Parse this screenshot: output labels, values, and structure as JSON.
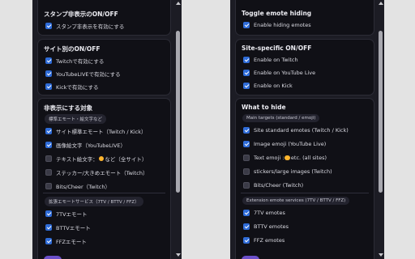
{
  "left": {
    "section1": {
      "title": "スタンプ非表示のON/OFF",
      "options": [
        {
          "label": "スタンプ非表示を有効にする",
          "checked": true
        }
      ]
    },
    "section2": {
      "title": "サイト別のON/OFF",
      "options": [
        {
          "label": "Twitchで有効にする",
          "checked": true
        },
        {
          "label": "YouTubeLIVEで有効にする",
          "checked": true
        },
        {
          "label": "Kickで有効にする",
          "checked": true
        }
      ]
    },
    "section3": {
      "title": "非表示にする対象",
      "group1_label": "標準エモート・絵文字など",
      "group1": [
        {
          "label": "サイト標準エモート（Twitch / Kick）",
          "checked": true
        },
        {
          "label": "画像絵文字（YouTubeLIVE）",
          "checked": true
        },
        {
          "label_before": "テキスト絵文字：",
          "label_after": "など（全サイト）",
          "checked": false
        },
        {
          "label": "ステッカー/大きめエモート（Twitch）",
          "checked": false
        },
        {
          "label": "Bits/Cheer（Twitch）",
          "checked": false
        }
      ],
      "group2_label": "拡張エモートサービス（7TV / BTTV / FFZ）",
      "group2": [
        {
          "label": "7TVエモート",
          "checked": true
        },
        {
          "label": "BTTVエモート",
          "checked": true
        },
        {
          "label": "FFZエモート",
          "checked": true
        }
      ]
    }
  },
  "right": {
    "section1": {
      "title": "Toggle emote hiding",
      "options": [
        {
          "label": "Enable hiding emotes",
          "checked": true
        }
      ]
    },
    "section2": {
      "title": "Site-specific ON/OFF",
      "options": [
        {
          "label": "Enable on Twitch",
          "checked": true
        },
        {
          "label": "Enable on YouTube Live",
          "checked": true
        },
        {
          "label": "Enable on Kick",
          "checked": true
        }
      ]
    },
    "section3": {
      "title": "What to hide",
      "group1_label": "Main targets (standard / emoji)",
      "group1": [
        {
          "label": "Site standard emotes (Twitch / Kick)",
          "checked": true
        },
        {
          "label": "Image emoji (YouTube Live)",
          "checked": true
        },
        {
          "label_before": "Text emoji :",
          "label_after": "etc. (all sites)",
          "checked": false
        },
        {
          "label": "stickers/large images (Twitch)",
          "checked": false
        },
        {
          "label": "Bits/Cheer (Twitch)",
          "checked": false
        }
      ],
      "group2_label": "Extension emote services (7TV / BTTV / FFZ)",
      "group2": [
        {
          "label": "7TV emotes",
          "checked": true
        },
        {
          "label": "BTTV emotes",
          "checked": true
        },
        {
          "label": "FFZ emotes",
          "checked": true
        }
      ]
    }
  },
  "colors": {
    "accent": "#2f6cd8",
    "panel_bg": "#1c1c24",
    "card_bg": "#101016",
    "page_bg": "#e3e3e3"
  }
}
